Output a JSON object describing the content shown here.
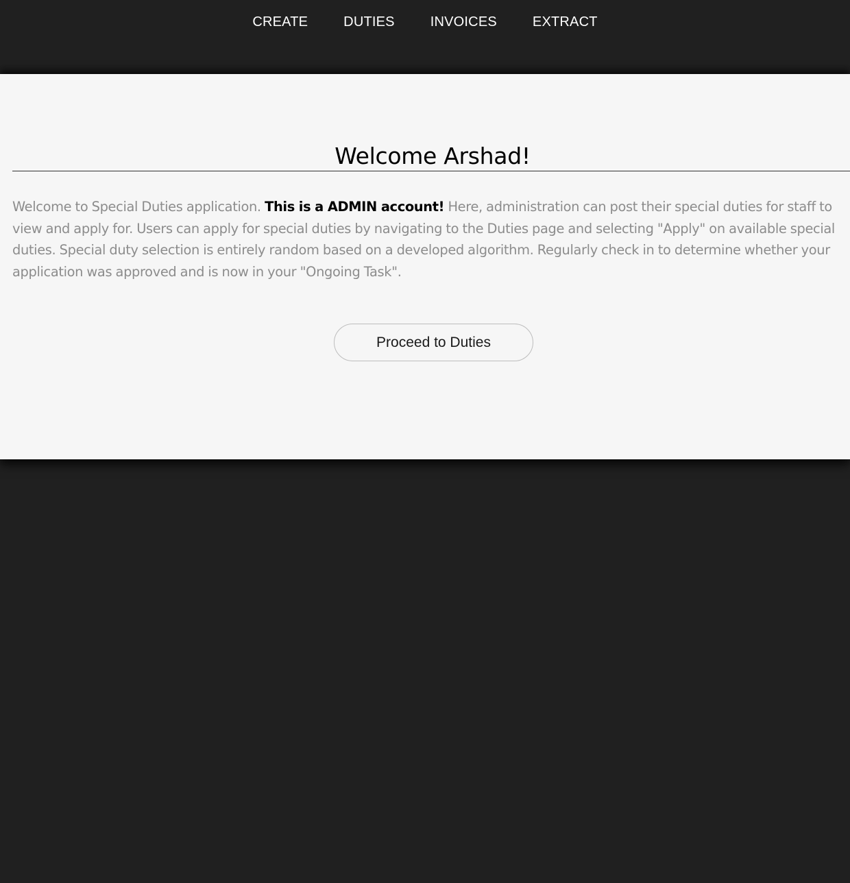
{
  "nav": {
    "items": [
      {
        "label": "CREATE"
      },
      {
        "label": "DUTIES"
      },
      {
        "label": "INVOICES"
      },
      {
        "label": "EXTRACT"
      }
    ]
  },
  "main": {
    "title": "Welcome Arshad!",
    "intro_lead": "Welcome to Special Duties application. ",
    "intro_emphasis": "This is a ADMIN account!",
    "intro_rest": " Here, administration can post their special duties for staff to view and apply for. Users can apply for special duties by navigating to the Duties page and selecting \"Apply\" on available special duties. Special duty selection is entirely random based on a developed algorithm. Regularly check in to determine whether your application was approved and is now in your \"Ongoing Task\".",
    "proceed_label": "Proceed to Duties"
  },
  "colors": {
    "background": "#202020",
    "panel": "#f6f6f6",
    "body_text": "#8c8c8c"
  }
}
